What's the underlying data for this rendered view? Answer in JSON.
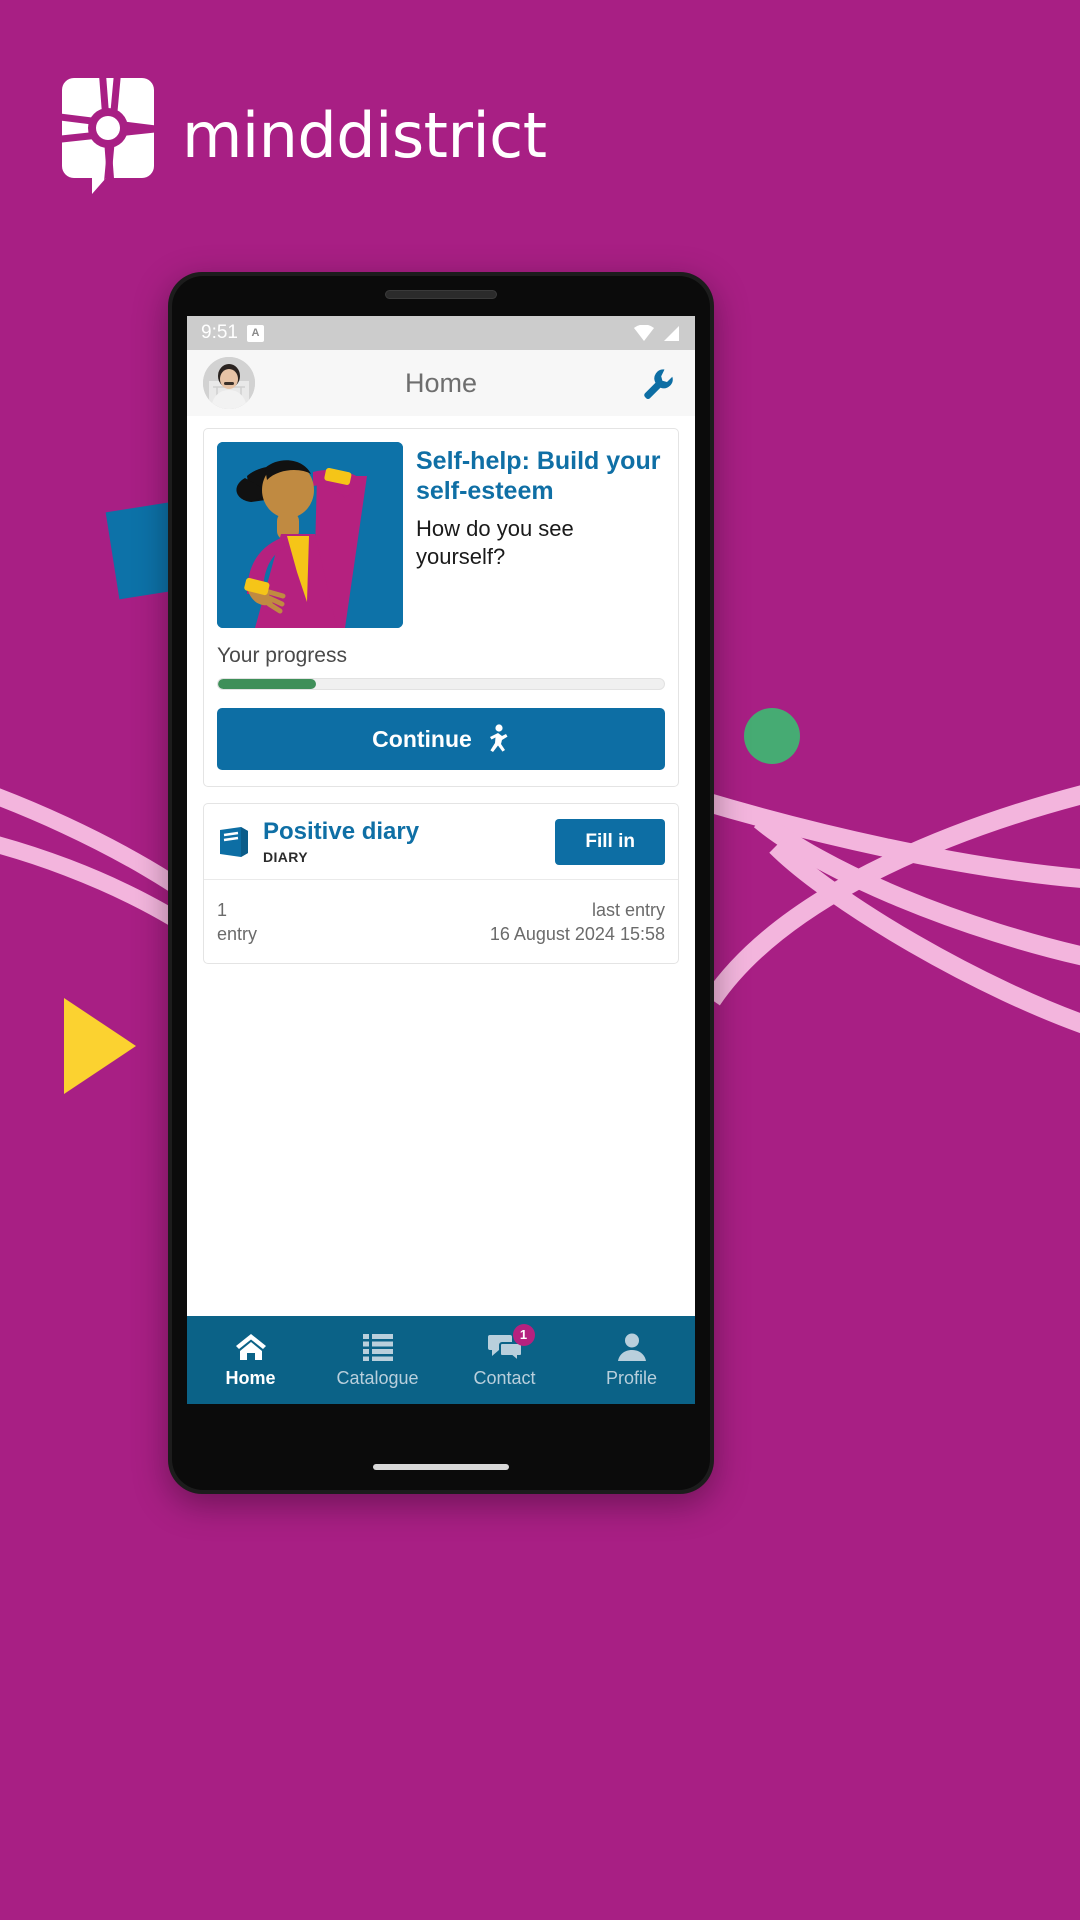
{
  "brand": {
    "name": "minddistrict",
    "logo_icon": "minddistrict-logo-icon",
    "background_color": "#a81f84",
    "accent_blue": "#0d6ea4",
    "accent_green": "#3f8f59",
    "accent_magenta": "#b5217f"
  },
  "decor": {
    "blue_square": "decorative-blue-square",
    "green_circle": "decorative-green-circle",
    "yellow_triangle": "decorative-yellow-triangle",
    "swooshes": "decorative-pink-swooshes"
  },
  "phone": {
    "statusbar": {
      "time": "9:51",
      "badge_letter": "A",
      "wifi_icon": "wifi-icon",
      "signal_icon": "cell-signal-icon"
    },
    "appbar": {
      "title": "Home",
      "avatar_icon": "user-avatar",
      "action_icon": "wrench-icon"
    },
    "self_help_card": {
      "thumbnail_icon": "self-esteem-illustration",
      "title": "Self-help: Build your self-esteem",
      "subtitle": "How do you see yourself?",
      "progress_label": "Your progress",
      "progress_percent": 22,
      "continue_label": "Continue",
      "continue_icon": "walking-person-icon"
    },
    "diary_card": {
      "icon": "diary-book-icon",
      "title": "Positive diary",
      "kind": "DIARY",
      "action_label": "Fill in",
      "entry_count": "1",
      "entry_count_label": "entry",
      "last_entry_label": "last entry",
      "last_entry_value": "16 August 2024 15:58"
    },
    "bottom_nav": [
      {
        "label": "Home",
        "icon": "home-icon",
        "active": true,
        "badge": ""
      },
      {
        "label": "Catalogue",
        "icon": "list-icon",
        "active": false,
        "badge": ""
      },
      {
        "label": "Contact",
        "icon": "chat-bubbles-icon",
        "active": false,
        "badge": "1"
      },
      {
        "label": "Profile",
        "icon": "person-icon",
        "active": false,
        "badge": ""
      }
    ]
  }
}
